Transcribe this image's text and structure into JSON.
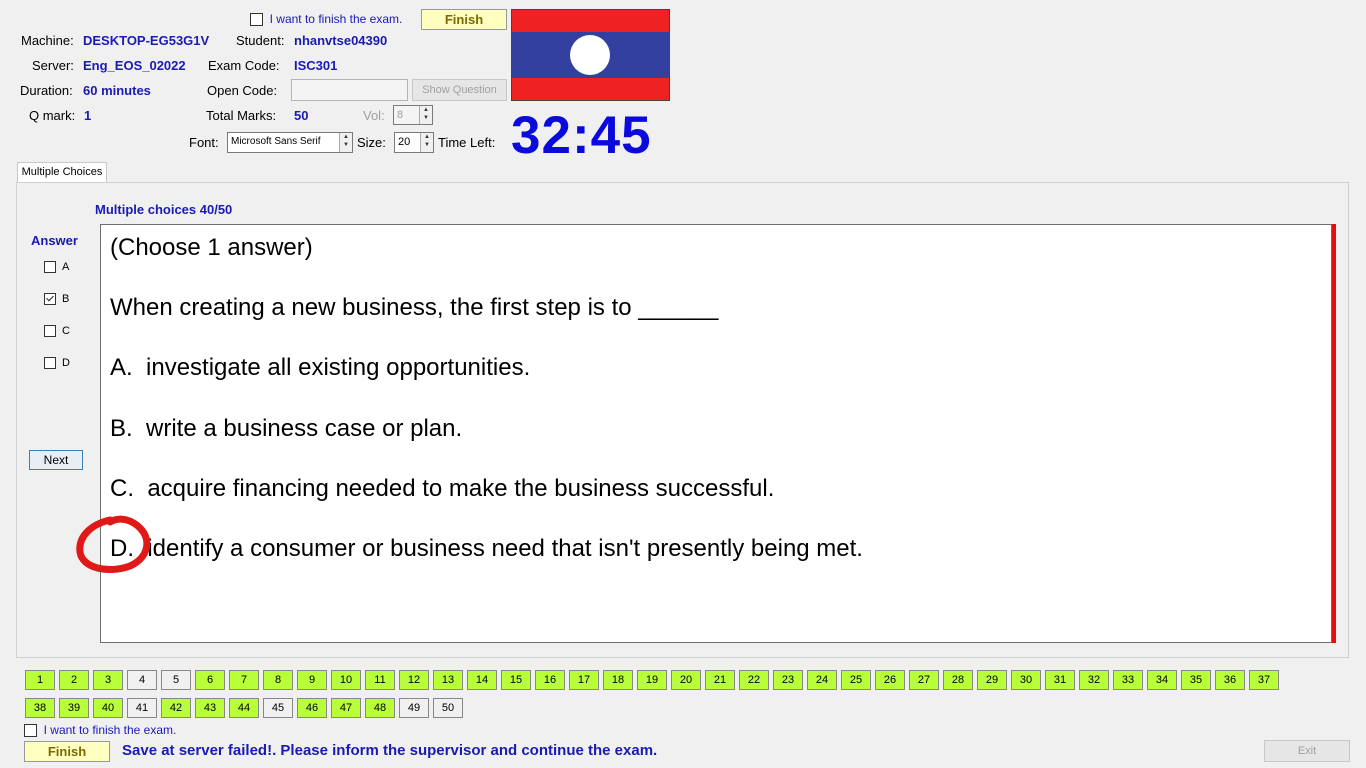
{
  "header": {
    "finish_checkbox_label": "I want to finish the exam.",
    "finish_button": "Finish",
    "machine_label": "Machine:",
    "machine_value": "DESKTOP-EG53G1V",
    "student_label": "Student:",
    "student_value": "nhanvtse04390",
    "server_label": "Server:",
    "server_value": "Eng_EOS_02022",
    "exam_code_label": "Exam Code:",
    "exam_code_value": "ISC301",
    "duration_label": "Duration:",
    "duration_value": "60 minutes",
    "open_code_label": "Open Code:",
    "open_code_value": "",
    "show_question_button": "Show Question",
    "q_mark_label": "Q mark:",
    "q_mark_value": "1",
    "total_marks_label": "Total Marks:",
    "total_marks_value": "50",
    "vol_label": "Vol:",
    "vol_value": "8",
    "font_label": "Font:",
    "font_value": "Microsoft Sans Serif",
    "size_label": "Size:",
    "size_value": "20",
    "time_left_label": "Time Left:",
    "timer": "32:45"
  },
  "flag": {
    "icon": "laos-flag",
    "colors": {
      "red": "#ee2222",
      "blue": "#3340a0",
      "white": "#ffffff"
    }
  },
  "tab_label": "Multiple Choices",
  "question_counter": "Multiple choices 40/50",
  "answer_panel": {
    "title": "Answer",
    "options": [
      {
        "label": "A",
        "checked": false
      },
      {
        "label": "B",
        "checked": true
      },
      {
        "label": "C",
        "checked": false
      },
      {
        "label": "D",
        "checked": false
      }
    ],
    "next_button": "Next"
  },
  "question": {
    "instruction": "(Choose 1 answer)",
    "stem": "When creating a new business, the first step is to ______",
    "choices": [
      "A.  investigate all existing opportunities.",
      "B.  write a business case or plan.",
      "C.  acquire financing needed to make the business successful.",
      "D.  identify a consumer or business need that isn't presently being met."
    ]
  },
  "question_nav": {
    "numbers": [
      "1",
      "2",
      "3",
      "4",
      "5",
      "6",
      "7",
      "8",
      "9",
      "10",
      "11",
      "12",
      "13",
      "14",
      "15",
      "16",
      "17",
      "18",
      "19",
      "20",
      "21",
      "22",
      "23",
      "24",
      "25",
      "26",
      "27",
      "28",
      "29",
      "30",
      "31",
      "32",
      "33",
      "34",
      "35",
      "36",
      "37",
      "38",
      "39",
      "40",
      "41",
      "42",
      "43",
      "44",
      "45",
      "46",
      "47",
      "48",
      "49",
      "50"
    ],
    "answered": [
      true,
      true,
      true,
      false,
      false,
      true,
      true,
      true,
      true,
      true,
      true,
      true,
      true,
      true,
      true,
      true,
      true,
      true,
      true,
      true,
      true,
      true,
      true,
      true,
      true,
      true,
      true,
      true,
      true,
      true,
      true,
      true,
      true,
      true,
      true,
      true,
      true,
      true,
      true,
      true,
      false,
      true,
      true,
      true,
      false,
      true,
      true,
      true,
      false,
      false
    ],
    "colors": {
      "answered": "#b8ff3a",
      "unanswered": "#f0f0f0"
    }
  },
  "footer": {
    "finish_checkbox_label": "I want to finish the exam.",
    "finish_button": "Finish",
    "status_message": "Save at server failed!. Please inform the supervisor and continue the exam.",
    "exit_button": "Exit"
  },
  "colors": {
    "accent_text": "#1a1ab4",
    "timer": "#0a0adc",
    "annotation_circle": "#e01818",
    "scroll_edge": "#e01010"
  }
}
